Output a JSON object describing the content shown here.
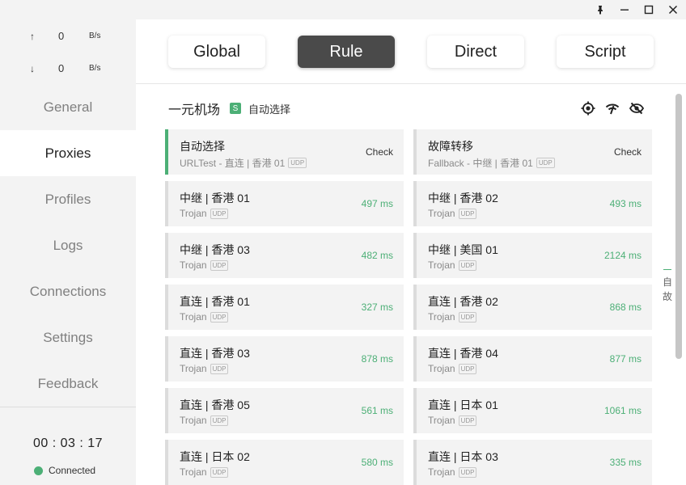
{
  "titlebar": {
    "pin_icon": "pin-icon",
    "minimize_icon": "minimize-icon",
    "maximize_icon": "maximize-icon",
    "close_icon": "close-icon"
  },
  "traffic": {
    "up_arrow": "↑",
    "up_value": "0",
    "up_unit": "B/s",
    "down_arrow": "↓",
    "down_value": "0",
    "down_unit": "B/s"
  },
  "nav": {
    "items": [
      {
        "label": "General"
      },
      {
        "label": "Proxies"
      },
      {
        "label": "Profiles"
      },
      {
        "label": "Logs"
      },
      {
        "label": "Connections"
      },
      {
        "label": "Settings"
      },
      {
        "label": "Feedback"
      }
    ],
    "active": "Proxies"
  },
  "status": {
    "timer": "00 : 03 : 17",
    "connection": "Connected",
    "dot_color": "#4caf76"
  },
  "modes": {
    "items": [
      {
        "label": "Global"
      },
      {
        "label": "Rule"
      },
      {
        "label": "Direct"
      },
      {
        "label": "Script"
      }
    ],
    "active": "Rule"
  },
  "group": {
    "name": "一元机场",
    "type_badge": "S",
    "selected_now": "自动选择",
    "tools": [
      "locate-icon",
      "delay-test-icon",
      "hide-icon"
    ]
  },
  "proxies": [
    {
      "name": "自动选择",
      "type": "URLTest - 直连 | 香港 01",
      "udp": "UDP",
      "action": "Check",
      "selected": true
    },
    {
      "name": "故障转移",
      "type": "Fallback - 中继 | 香港 01",
      "udp": "UDP",
      "action": "Check",
      "selected": false
    },
    {
      "name": "中继 | 香港 01",
      "type": "Trojan",
      "udp": "UDP",
      "delay": "497 ms"
    },
    {
      "name": "中继 | 香港 02",
      "type": "Trojan",
      "udp": "UDP",
      "delay": "493 ms"
    },
    {
      "name": "中继 | 香港 03",
      "type": "Trojan",
      "udp": "UDP",
      "delay": "482 ms"
    },
    {
      "name": "中继 | 美国 01",
      "type": "Trojan",
      "udp": "UDP",
      "delay": "2124 ms"
    },
    {
      "name": "直连 | 香港 01",
      "type": "Trojan",
      "udp": "UDP",
      "delay": "327 ms"
    },
    {
      "name": "直连 | 香港 02",
      "type": "Trojan",
      "udp": "UDP",
      "delay": "868 ms"
    },
    {
      "name": "直连 | 香港 03",
      "type": "Trojan",
      "udp": "UDP",
      "delay": "878 ms"
    },
    {
      "name": "直连 | 香港 04",
      "type": "Trojan",
      "udp": "UDP",
      "delay": "877 ms"
    },
    {
      "name": "直连 | 香港 05",
      "type": "Trojan",
      "udp": "UDP",
      "delay": "561 ms"
    },
    {
      "name": "直连 | 日本 01",
      "type": "Trojan",
      "udp": "UDP",
      "delay": "1061 ms"
    },
    {
      "name": "直连 | 日本 02",
      "type": "Trojan",
      "udp": "UDP",
      "delay": "580 ms"
    },
    {
      "name": "直连 | 日本 03",
      "type": "Trojan",
      "udp": "UDP",
      "delay": "335 ms"
    }
  ],
  "index_bar": [
    "自",
    "故"
  ],
  "colors": {
    "accent": "#4caf76",
    "active_mode_bg": "#4a4a4a",
    "sidebar_bg": "#f3f3f3"
  }
}
